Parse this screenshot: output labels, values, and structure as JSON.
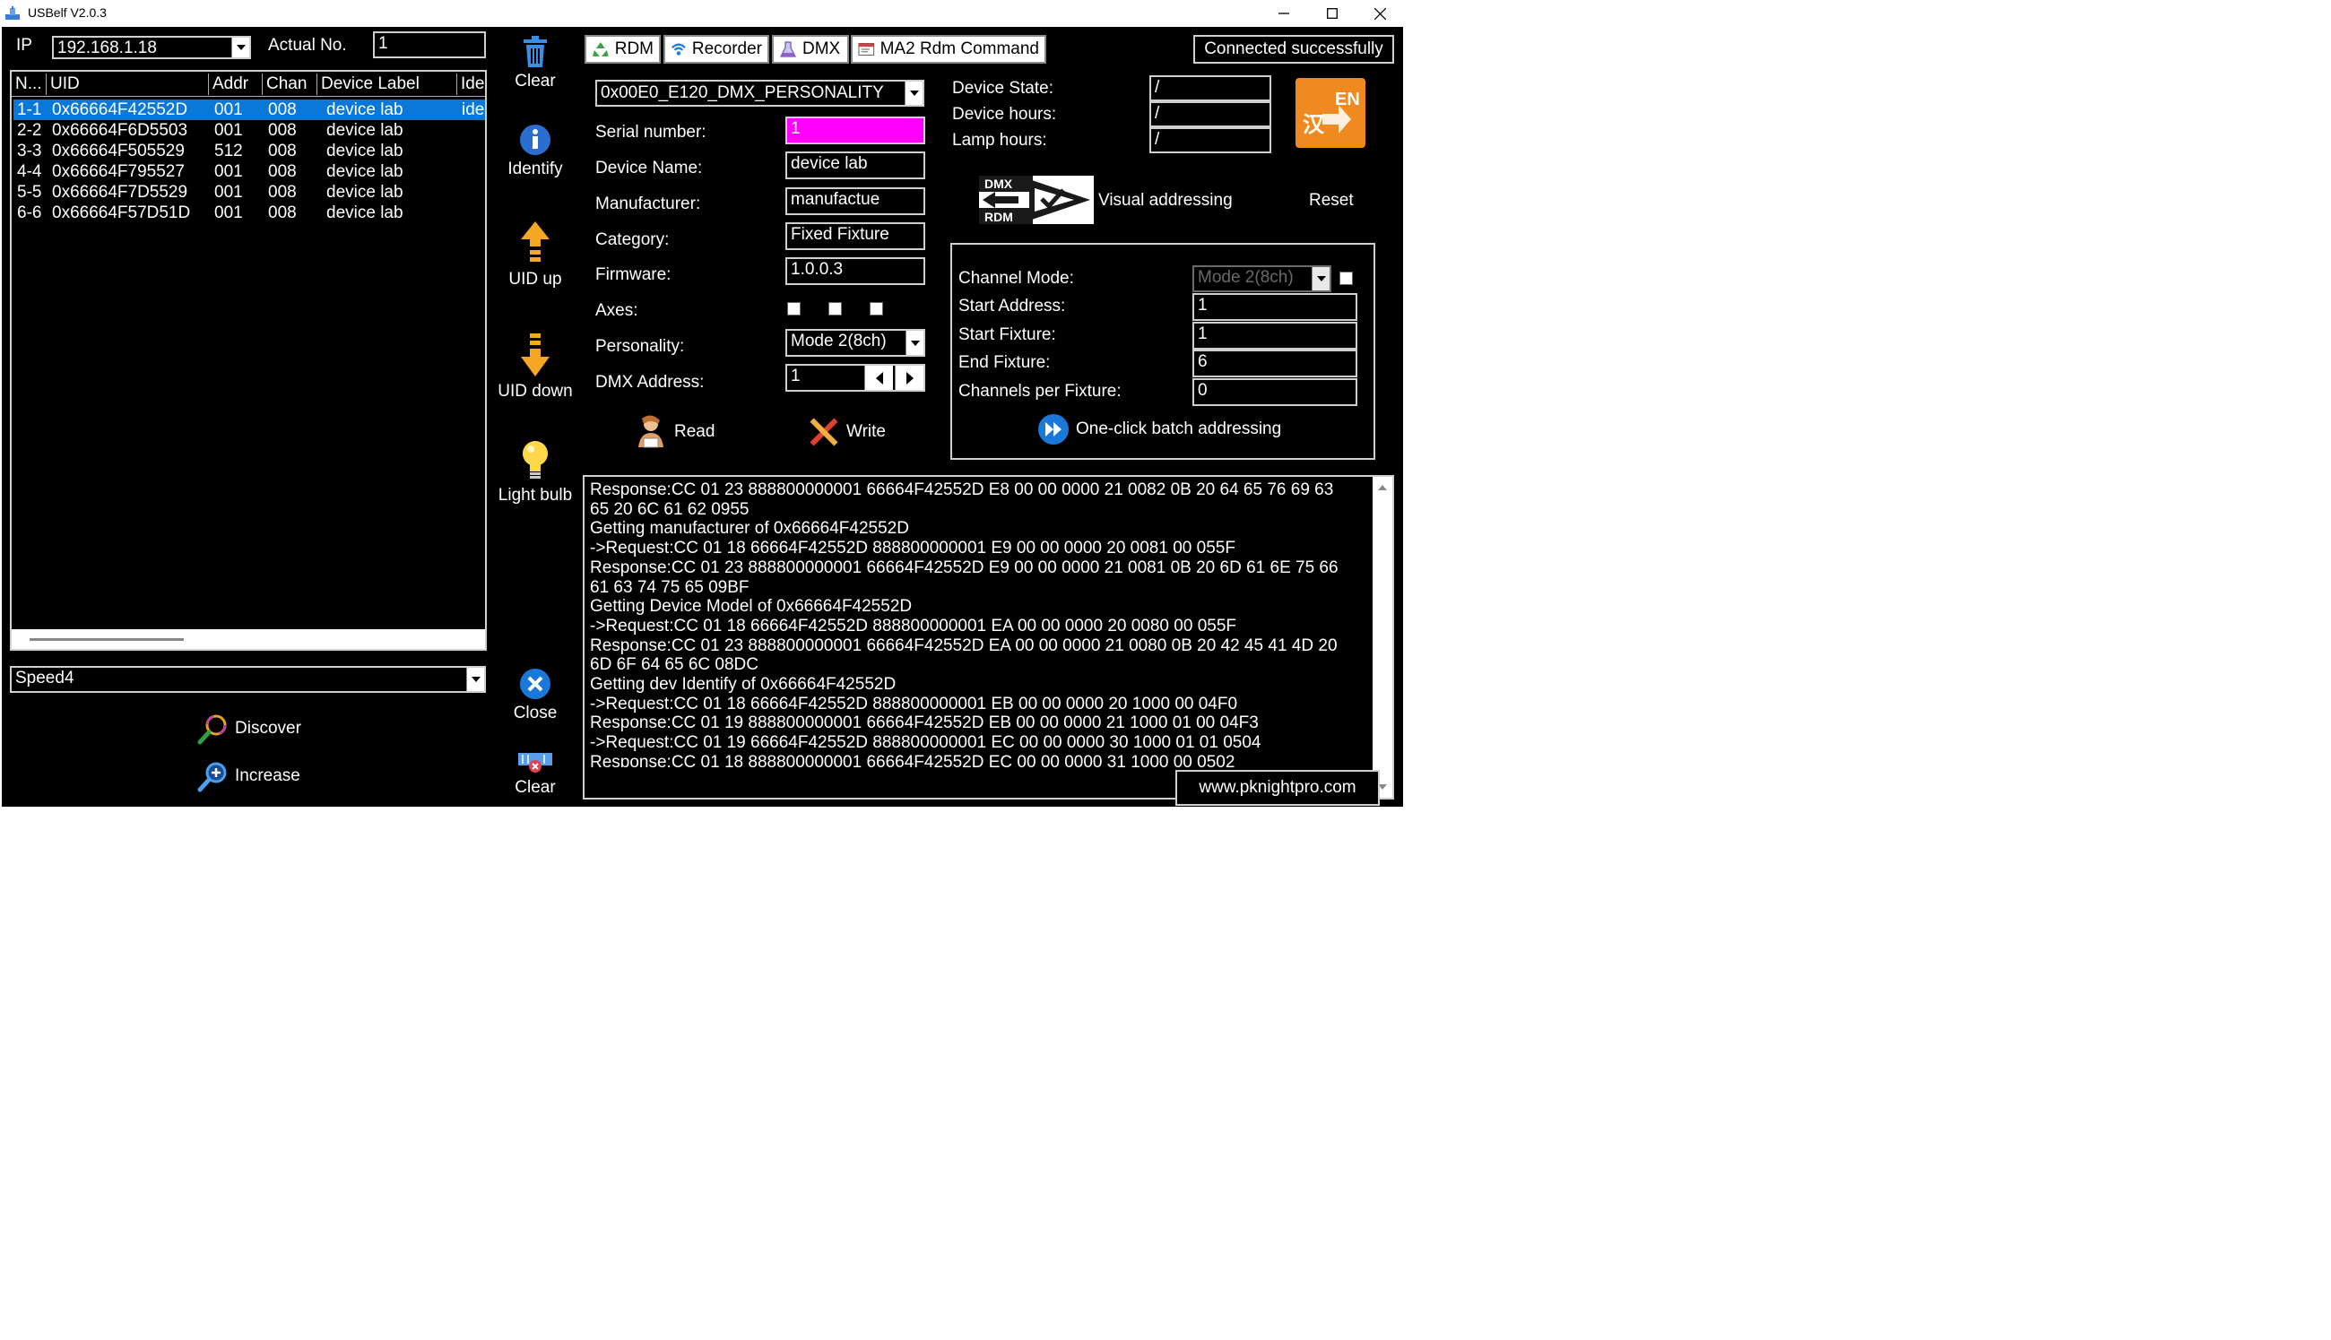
{
  "window": {
    "title": "USBelf V2.0.3"
  },
  "left": {
    "ip_label": "IP",
    "ip_value": "192.168.1.18",
    "actual_no_label": "Actual No.",
    "actual_no_value": "1",
    "table": {
      "headers": [
        "N...",
        "UID",
        "Addr",
        "Chan",
        "Device Label",
        "Ide"
      ],
      "rows": [
        {
          "n": "1-1",
          "uid": "0x66664F42552D",
          "addr": "001",
          "chan": "008",
          "label": "device lab",
          "ide": "ide"
        },
        {
          "n": "2-2",
          "uid": "0x66664F6D5503",
          "addr": "001",
          "chan": "008",
          "label": "device lab",
          "ide": ""
        },
        {
          "n": "3-3",
          "uid": "0x66664F505529",
          "addr": "512",
          "chan": "008",
          "label": "device lab",
          "ide": ""
        },
        {
          "n": "4-4",
          "uid": "0x66664F795527",
          "addr": "001",
          "chan": "008",
          "label": "device lab",
          "ide": ""
        },
        {
          "n": "5-5",
          "uid": "0x66664F7D5529",
          "addr": "001",
          "chan": "008",
          "label": "device lab",
          "ide": ""
        },
        {
          "n": "6-6",
          "uid": "0x66664F57D51D",
          "addr": "001",
          "chan": "008",
          "label": "device lab",
          "ide": ""
        }
      ]
    },
    "speed_value": "Speed4",
    "discover_label": "Discover",
    "increase_label": "Increase"
  },
  "toolbar": {
    "clear_label": "Clear",
    "identify_label": "Identify",
    "uid_up_label": "UID up",
    "uid_down_label": "UID down",
    "light_bulb_label": "Light bulb",
    "close_label": "Close",
    "clear2_label": "Clear"
  },
  "tabs": [
    {
      "label": "RDM",
      "icon": "recycle-icon"
    },
    {
      "label": "Recorder",
      "icon": "wifi-icon"
    },
    {
      "label": "DMX",
      "icon": "flask-icon"
    },
    {
      "label": "MA2 Rdm Command",
      "icon": "window-icon"
    }
  ],
  "status": "Connected successfully",
  "rdm": {
    "pid_value": "0x00E0_E120_DMX_PERSONALITY",
    "serial_label": "Serial number:",
    "serial_value": "1",
    "device_name_label": "Device Name:",
    "device_name_value": "device lab",
    "manufacturer_label": "Manufacturer:",
    "manufacturer_value": "manufactue",
    "category_label": "Category:",
    "category_value": "Fixed Fixture",
    "firmware_label": "Firmware:",
    "firmware_value": "1.0.0.3",
    "axes_label": "Axes:",
    "personality_label": "Personality:",
    "personality_value": "Mode 2(8ch)",
    "dmx_address_label": "DMX Address:",
    "dmx_address_value": "1",
    "read_label": "Read",
    "write_label": "Write",
    "device_state_label": "Device State:",
    "device_state_value": "/",
    "device_hours_label": "Device hours:",
    "device_hours_value": "/",
    "lamp_hours_label": "Lamp hours:",
    "lamp_hours_value": "/",
    "visual_addressing_label": "Visual addressing",
    "reset_label": "Reset",
    "logo_dmx": "DMX",
    "logo_rdm": "RDM",
    "lang_icon_text_top": "EN",
    "lang_icon_text_bottom": "汉"
  },
  "batch": {
    "channel_mode_label": "Channel Mode:",
    "channel_mode_value": "Mode 2(8ch)",
    "start_address_label": "Start Address:",
    "start_address_value": "1",
    "start_fixture_label": "Start Fixture:",
    "start_fixture_value": "1",
    "end_fixture_label": "End Fixture:",
    "end_fixture_value": "6",
    "channels_per_fixture_label": "Channels per Fixture:",
    "channels_per_fixture_value": "0",
    "batch_button_label": "One-click batch addressing"
  },
  "log": [
    "Response:CC 01 23 888800000001 66664F42552D E8 00 00 0000 21 0082 0B 20 64 65 76 69 63",
    "65 20 6C 61 62 0955",
    "Getting manufacturer of 0x66664F42552D",
    "->Request:CC 01 18 66664F42552D 888800000001 E9 00 00 0000 20 0081 00 055F",
    "Response:CC 01 23 888800000001 66664F42552D E9 00 00 0000 21 0081 0B 20 6D 61 6E 75 66",
    "61 63 74 75 65 09BF",
    "Getting Device Model of 0x66664F42552D",
    "->Request:CC 01 18 66664F42552D 888800000001 EA 00 00 0000 20 0080 00 055F",
    "Response:CC 01 23 888800000001 66664F42552D EA 00 00 0000 21 0080 0B 20 42 45 41 4D 20",
    "6D 6F 64 65 6C 08DC",
    "Getting dev Identify of 0x66664F42552D",
    "->Request:CC 01 18 66664F42552D 888800000001 EB 00 00 0000 20 1000 00 04F0",
    "Response:CC 01 19 888800000001 66664F42552D EB 00 00 0000 21 1000 01 00 04F3",
    "->Request:CC 01 19 66664F42552D 888800000001 EC 00 00 0000 30 1000 01 01 0504",
    "Response:CC 01 18 888800000001 66664F42552D EC 00 00 0000 31 1000 00 0502"
  ],
  "website": "www.pknightpro.com",
  "colors": {
    "selection": "#0a78d7",
    "serial_highlight": "#ff00ff",
    "accent_orange": "#f5a623"
  }
}
